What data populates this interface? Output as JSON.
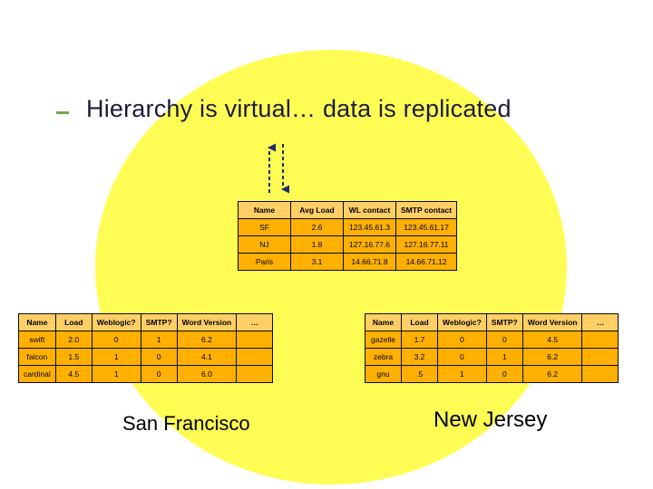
{
  "title": "Hierarchy is virtual… data is replicated",
  "top_table": {
    "headers": [
      "Name",
      "Avg Load",
      "WL contact",
      "SMTP contact"
    ],
    "rows": [
      [
        "SF",
        "2.6",
        "123.45.61.3",
        "123.45.61.17"
      ],
      [
        "NJ",
        "1.8",
        "127.16.77.6",
        "127.16.77.11"
      ],
      [
        "Paris",
        "3.1",
        "14.66.71.8",
        "14.66.71.12"
      ]
    ]
  },
  "sf_table": {
    "headers": [
      "Name",
      "Load",
      "Weblogic?",
      "SMTP?",
      "Word Version",
      "…"
    ],
    "rows": [
      [
        "swift",
        "2.0",
        "0",
        "1",
        "6.2",
        ""
      ],
      [
        "falcon",
        "1.5",
        "1",
        "0",
        "4.1",
        ""
      ],
      [
        "cardinal",
        "4.5",
        "1",
        "0",
        "6.0",
        ""
      ]
    ]
  },
  "nj_table": {
    "headers": [
      "Name",
      "Load",
      "Weblogic?",
      "SMTP?",
      "Word Version",
      "…"
    ],
    "rows": [
      [
        "gazelle",
        "1.7",
        "0",
        "0",
        "4.5",
        ""
      ],
      [
        "zebra",
        "3.2",
        "0",
        "1",
        "6.2",
        ""
      ],
      [
        "gnu",
        ".5",
        "1",
        "0",
        "6.2",
        ""
      ]
    ]
  },
  "labels": {
    "sf": "San Francisco",
    "nj": "New Jersey"
  }
}
